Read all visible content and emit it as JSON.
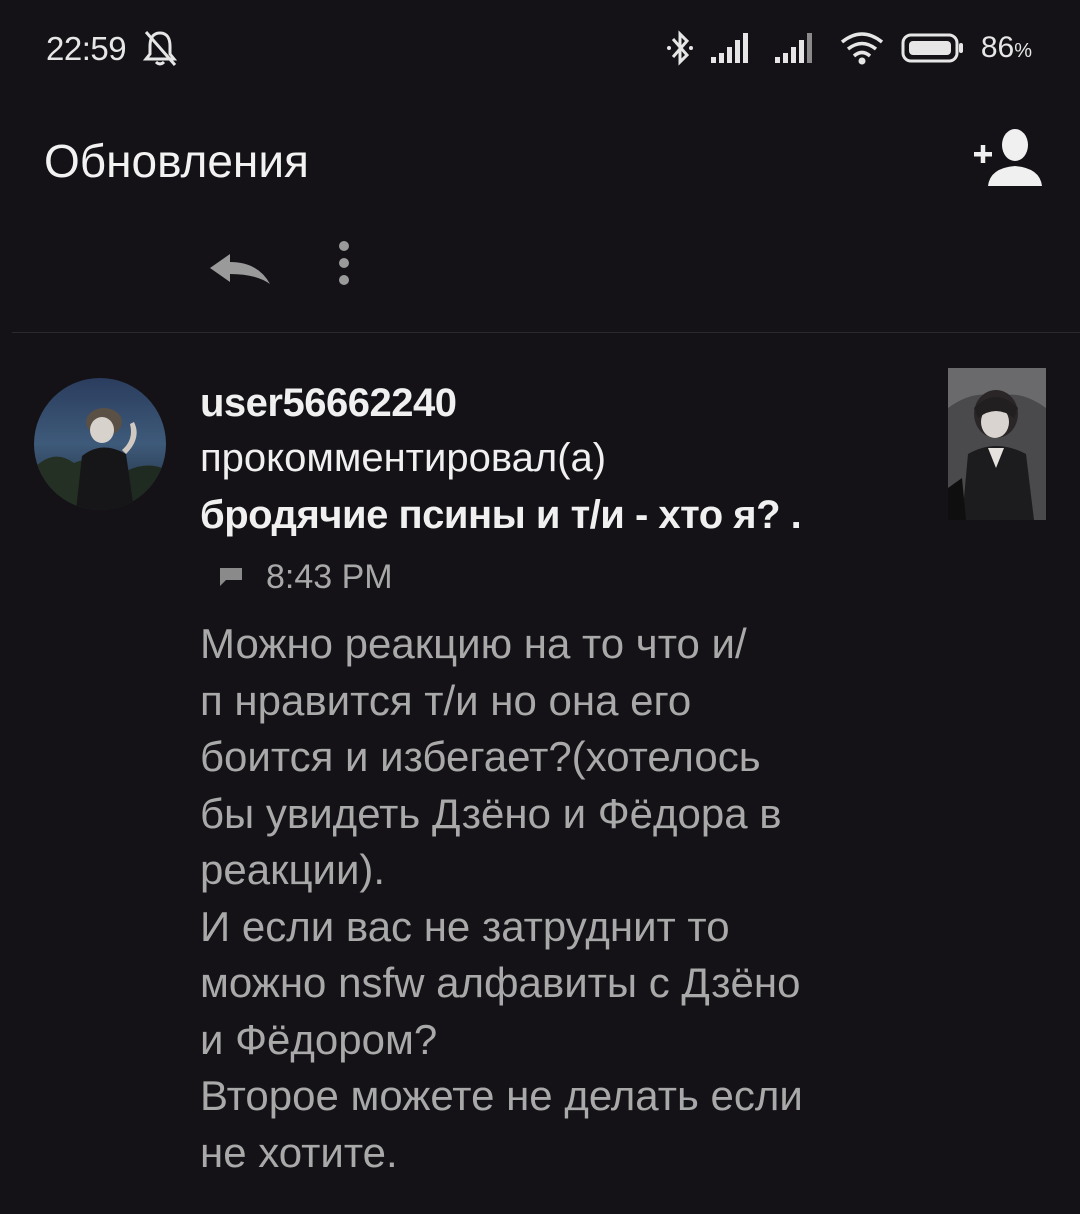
{
  "status_bar": {
    "time": "22:59",
    "battery_percent": "86",
    "battery_unit": "%",
    "icons": [
      "mute-icon",
      "bluetooth-icon",
      "signal-icon",
      "signal-icon",
      "wifi-icon",
      "battery-icon"
    ]
  },
  "app_bar": {
    "title": "Обновления",
    "action_icon": "add-user-icon"
  },
  "previous_item": {
    "actions": [
      "reply-icon",
      "more-icon"
    ]
  },
  "notification": {
    "username": "user56662240",
    "action": "прокомментировал(а)",
    "story_title": "бродячие псины и т/и - хто я? .",
    "time": "8:43 PM",
    "comment": "Можно реакцию на то что и/\nп нравится т/и но она его\nбоится и избегает?(хотелось\nбы увидеть Дзёно и Фёдора в\nреакции).\nИ если вас не затруднит то\nможно nsfw алфавиты с Дзёно\nи Фёдором?\nВторое можете не делать если\nне хотите."
  },
  "colors": {
    "background": "#141216",
    "primary_text": "#f0f0f0",
    "secondary_text": "#a9a9a9",
    "divider": "#2c2a2f"
  }
}
